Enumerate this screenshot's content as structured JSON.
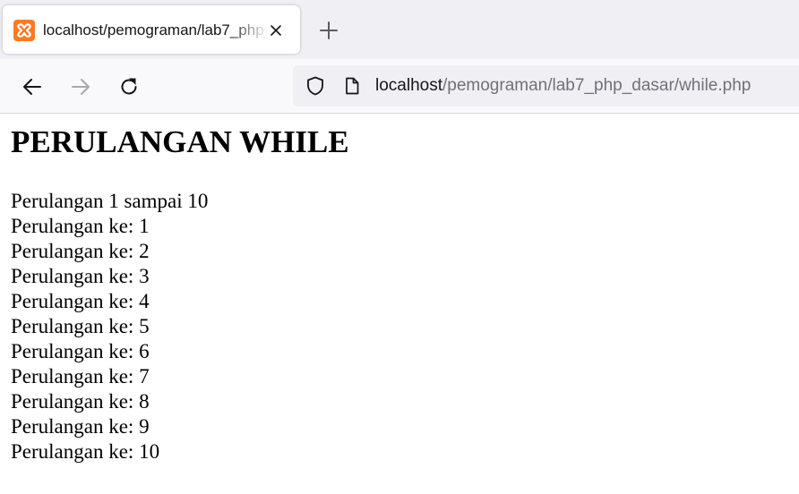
{
  "browser": {
    "tab": {
      "title": "localhost/pemograman/lab7_php_dasar/while.php",
      "favicon": "xampp-logo",
      "close_icon": "close-icon"
    },
    "new_tab_icon": "plus-icon",
    "nav": {
      "back_icon": "arrow-left-icon",
      "forward_icon": "arrow-right-icon",
      "reload_icon": "reload-icon"
    },
    "url": {
      "host": "localhost",
      "path": "/pemograman/lab7_php_dasar/while.php",
      "security_icon": "shield-icon",
      "page_icon": "page-icon"
    },
    "colors": {
      "tabstrip_bg": "#f0f0f4",
      "favicon_orange": "#fb7a24",
      "url_host": "#15141a",
      "url_path": "#707076"
    }
  },
  "page": {
    "heading": "PERULANGAN WHILE",
    "intro": "Perulangan 1 sampai 10",
    "items": [
      "Perulangan ke: 1",
      "Perulangan ke: 2",
      "Perulangan ke: 3",
      "Perulangan ke: 4",
      "Perulangan ke: 5",
      "Perulangan ke: 6",
      "Perulangan ke: 7",
      "Perulangan ke: 8",
      "Perulangan ke: 9",
      "Perulangan ke: 10"
    ]
  }
}
